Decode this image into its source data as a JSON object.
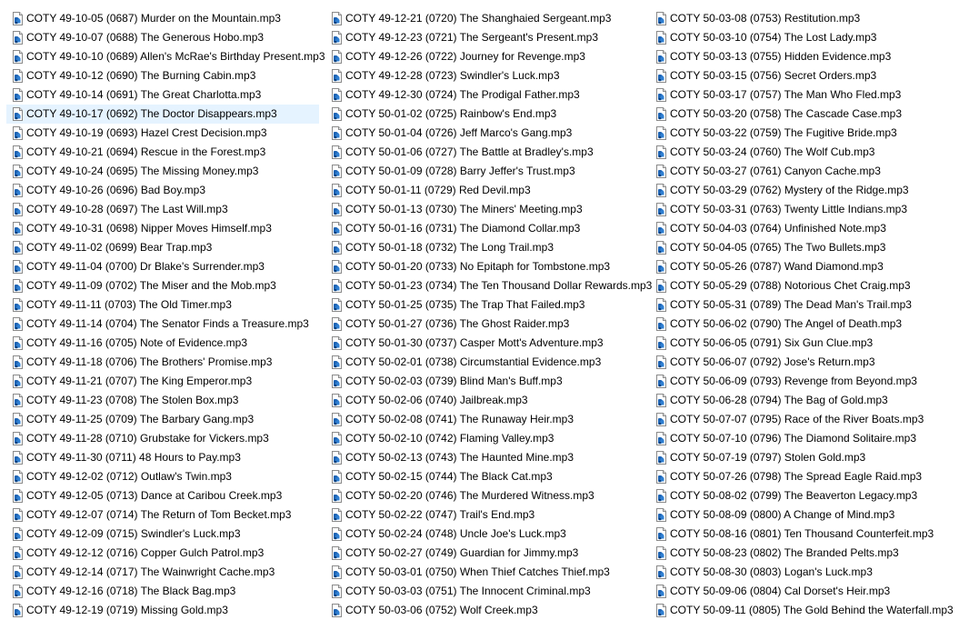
{
  "selected": "COTY 49-10-17 (0692) The Doctor Disappears.mp3",
  "file_icon": "audio-file-icon",
  "columns": [
    [
      "COTY 49-10-05 (0687) Murder on the Mountain.mp3",
      "COTY 49-10-07 (0688) The Generous Hobo.mp3",
      "COTY 49-10-10 (0689) Allen's McRae's Birthday Present.mp3",
      "COTY 49-10-12 (0690) The Burning Cabin.mp3",
      "COTY 49-10-14 (0691) The Great Charlotta.mp3",
      "COTY 49-10-17 (0692) The Doctor Disappears.mp3",
      "COTY 49-10-19 (0693) Hazel Crest Decision.mp3",
      "COTY 49-10-21 (0694) Rescue in the Forest.mp3",
      "COTY 49-10-24 (0695) The Missing Money.mp3",
      "COTY 49-10-26 (0696) Bad Boy.mp3",
      "COTY 49-10-28 (0697) The Last Will.mp3",
      "COTY 49-10-31 (0698) Nipper Moves Himself.mp3",
      "COTY 49-11-02 (0699) Bear Trap.mp3",
      "COTY 49-11-04 (0700) Dr Blake's Surrender.mp3",
      "COTY 49-11-09 (0702) The Miser and the Mob.mp3",
      "COTY 49-11-11 (0703) The Old Timer.mp3",
      "COTY 49-11-14 (0704) The Senator Finds a Treasure.mp3",
      "COTY 49-11-16 (0705) Note of Evidence.mp3",
      "COTY 49-11-18 (0706) The Brothers' Promise.mp3",
      "COTY 49-11-21 (0707) The King Emperor.mp3",
      "COTY 49-11-23 (0708) The Stolen Box.mp3",
      "COTY 49-11-25 (0709) The Barbary Gang.mp3",
      "COTY 49-11-28 (0710) Grubstake for Vickers.mp3",
      "COTY 49-11-30 (0711) 48 Hours to Pay.mp3",
      "COTY 49-12-02 (0712) Outlaw's Twin.mp3",
      "COTY 49-12-05 (0713) Dance at Caribou Creek.mp3",
      "COTY 49-12-07 (0714) The Return of Tom Becket.mp3",
      "COTY 49-12-09 (0715) Swindler's Luck.mp3",
      "COTY 49-12-12 (0716) Copper Gulch Patrol.mp3",
      "COTY 49-12-14 (0717) The Wainwright Cache.mp3",
      "COTY 49-12-16 (0718) The Black Bag.mp3",
      "COTY 49-12-19 (0719) Missing Gold.mp3"
    ],
    [
      "COTY 49-12-21 (0720) The Shanghaied Sergeant.mp3",
      "COTY 49-12-23 (0721) The Sergeant's Present.mp3",
      "COTY 49-12-26 (0722) Journey for Revenge.mp3",
      "COTY 49-12-28 (0723) Swindler's Luck.mp3",
      "COTY 49-12-30 (0724) The Prodigal Father.mp3",
      "COTY 50-01-02 (0725) Rainbow's End.mp3",
      "COTY 50-01-04 (0726) Jeff Marco's Gang.mp3",
      "COTY 50-01-06 (0727) The Battle at Bradley's.mp3",
      "COTY 50-01-09 (0728) Barry Jeffer's Trust.mp3",
      "COTY 50-01-11 (0729) Red Devil.mp3",
      "COTY 50-01-13 (0730) The Miners' Meeting.mp3",
      "COTY 50-01-16 (0731) The Diamond Collar.mp3",
      "COTY 50-01-18 (0732) The Long Trail.mp3",
      "COTY 50-01-20 (0733) No Epitaph for Tombstone.mp3",
      "COTY 50-01-23 (0734) The Ten Thousand Dollar Rewards.mp3",
      "COTY 50-01-25 (0735) The Trap That Failed.mp3",
      "COTY 50-01-27 (0736) The Ghost Raider.mp3",
      "COTY 50-01-30 (0737) Casper Mott's Adventure.mp3",
      "COTY 50-02-01 (0738) Circumstantial Evidence.mp3",
      "COTY 50-02-03 (0739) Blind Man's Buff.mp3",
      "COTY 50-02-06 (0740) Jailbreak.mp3",
      "COTY 50-02-08 (0741) The Runaway Heir.mp3",
      "COTY 50-02-10 (0742) Flaming Valley.mp3",
      "COTY 50-02-13 (0743) The Haunted Mine.mp3",
      "COTY 50-02-15 (0744) The Black Cat.mp3",
      "COTY 50-02-20 (0746) The Murdered Witness.mp3",
      "COTY 50-02-22 (0747) Trail's End.mp3",
      "COTY 50-02-24 (0748) Uncle Joe's Luck.mp3",
      "COTY 50-02-27 (0749) Guardian for Jimmy.mp3",
      "COTY 50-03-01 (0750) When Thief Catches Thief.mp3",
      "COTY 50-03-03 (0751) The Innocent Criminal.mp3",
      "COTY 50-03-06 (0752) Wolf Creek.mp3"
    ],
    [
      "COTY 50-03-08 (0753) Restitution.mp3",
      "COTY 50-03-10 (0754) The Lost Lady.mp3",
      "COTY 50-03-13 (0755) Hidden Evidence.mp3",
      "COTY 50-03-15 (0756) Secret Orders.mp3",
      "COTY 50-03-17 (0757) The Man Who Fled.mp3",
      "COTY 50-03-20 (0758) The Cascade Case.mp3",
      "COTY 50-03-22 (0759) The Fugitive Bride.mp3",
      "COTY 50-03-24 (0760) The Wolf Cub.mp3",
      "COTY 50-03-27 (0761) Canyon Cache.mp3",
      "COTY 50-03-29 (0762) Mystery of the Ridge.mp3",
      "COTY 50-03-31 (0763) Twenty Little Indians.mp3",
      "COTY 50-04-03 (0764) Unfinished Note.mp3",
      "COTY 50-04-05 (0765) The Two Bullets.mp3",
      "COTY 50-05-26 (0787) Wand Diamond.mp3",
      "COTY 50-05-29 (0788) Notorious Chet Craig.mp3",
      "COTY 50-05-31 (0789) The Dead Man's Trail.mp3",
      "COTY 50-06-02 (0790) The Angel of Death.mp3",
      "COTY 50-06-05 (0791) Six Gun Clue.mp3",
      "COTY 50-06-07 (0792) Jose's Return.mp3",
      "COTY 50-06-09 (0793) Revenge from Beyond.mp3",
      "COTY 50-06-28 (0794) The Bag of Gold.mp3",
      "COTY 50-07-07 (0795) Race of the River Boats.mp3",
      "COTY 50-07-10 (0796) The Diamond Solitaire.mp3",
      "COTY 50-07-19 (0797) Stolen Gold.mp3",
      "COTY 50-07-26 (0798) The Spread Eagle Raid.mp3",
      "COTY 50-08-02 (0799) The Beaverton Legacy.mp3",
      "COTY 50-08-09 (0800) A Change of Mind.mp3",
      "COTY 50-08-16 (0801) Ten Thousand Counterfeit.mp3",
      "COTY 50-08-23 (0802) The Branded Pelts.mp3",
      "COTY 50-08-30 (0803) Logan's Luck.mp3",
      "COTY 50-09-06 (0804) Cal Dorset's Heir.mp3",
      "COTY 50-09-11 (0805) The Gold Behind the Waterfall.mp3"
    ]
  ]
}
